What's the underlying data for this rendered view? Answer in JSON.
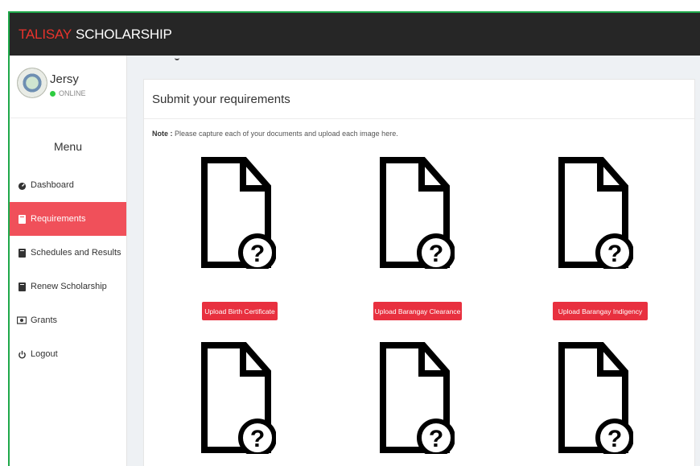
{
  "brand": {
    "part1": "TALISAY",
    "part2": "SCHOLARSHIP"
  },
  "user": {
    "name": "Jersy",
    "status": "ONLINE"
  },
  "menu": {
    "title": "Menu",
    "items": [
      {
        "label": "Dashboard",
        "icon": "tachometer-icon"
      },
      {
        "label": "Requirements",
        "icon": "book-icon",
        "active": true
      },
      {
        "label": "Schedules and Results",
        "icon": "book-icon"
      },
      {
        "label": "Renew Scholarship",
        "icon": "book-icon"
      },
      {
        "label": "Grants",
        "icon": "money-icon"
      },
      {
        "label": "Logout",
        "icon": "power-icon"
      }
    ]
  },
  "panel": {
    "title": "Submit your requirements",
    "note_label": "Note :",
    "note_text": "Please capture each of your documents and upload each image here."
  },
  "uploads": [
    {
      "label": "Upload Birth Certificate"
    },
    {
      "label": "Upload Barangay Clearance"
    },
    {
      "label": "Upload Barangay Indigency"
    }
  ],
  "colors": {
    "accent": "#e8303f",
    "topbar": "#262626",
    "brand_red": "#e8332c",
    "online": "#2ecc40"
  }
}
